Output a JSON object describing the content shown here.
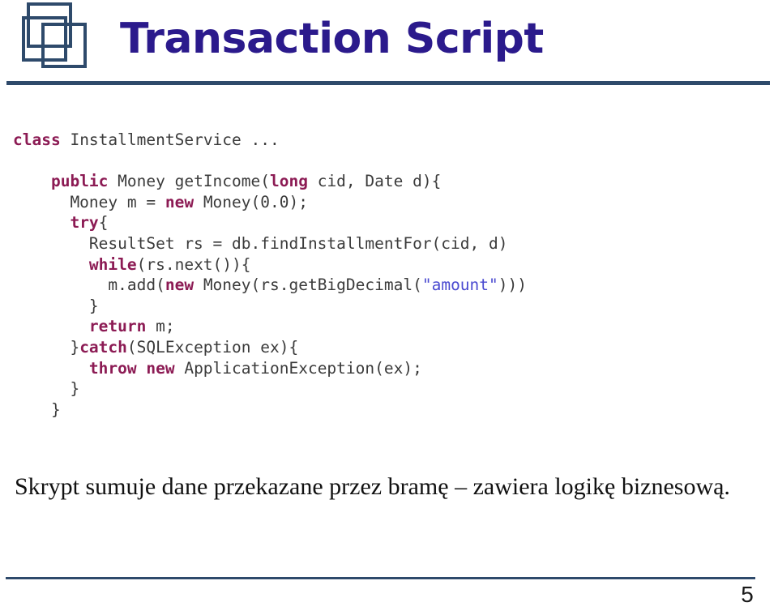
{
  "slide": {
    "title": "Transaction Script",
    "page_number": "5",
    "colors": {
      "title": "#2b1a8c",
      "rule": "#2e4a6b",
      "logo": "#2e4a6b",
      "code_keyword": "#8c1b54",
      "code_string": "#4a4ad0",
      "code_plain": "#3b3b3b",
      "body_text": "#111111",
      "background": "#ffffff"
    },
    "logo": {
      "icon_name": "three-overlapping-squares-logo"
    }
  },
  "code": {
    "language": "java",
    "lines": [
      [
        {
          "t": "class ",
          "c": "kw"
        },
        {
          "t": "InstallmentService ...",
          "c": "plain"
        }
      ],
      [],
      [
        {
          "t": "    ",
          "c": "plain"
        },
        {
          "t": "public ",
          "c": "kw"
        },
        {
          "t": "Money getIncome(",
          "c": "plain"
        },
        {
          "t": "long ",
          "c": "kw"
        },
        {
          "t": "cid, Date d){",
          "c": "plain"
        }
      ],
      [
        {
          "t": "      Money m = ",
          "c": "plain"
        },
        {
          "t": "new ",
          "c": "kw"
        },
        {
          "t": "Money(0.0);",
          "c": "plain"
        }
      ],
      [
        {
          "t": "      ",
          "c": "plain"
        },
        {
          "t": "try",
          "c": "kw"
        },
        {
          "t": "{",
          "c": "plain"
        }
      ],
      [
        {
          "t": "        ResultSet rs = db.findInstallmentFor(cid, d)",
          "c": "plain"
        }
      ],
      [
        {
          "t": "        ",
          "c": "plain"
        },
        {
          "t": "while",
          "c": "kw"
        },
        {
          "t": "(rs.next()){",
          "c": "plain"
        }
      ],
      [
        {
          "t": "          m.add(",
          "c": "plain"
        },
        {
          "t": "new ",
          "c": "kw"
        },
        {
          "t": "Money(rs.getBigDecimal(",
          "c": "plain"
        },
        {
          "t": "\"amount\"",
          "c": "str"
        },
        {
          "t": ")))",
          "c": "plain"
        }
      ],
      [
        {
          "t": "        }",
          "c": "plain"
        }
      ],
      [
        {
          "t": "        ",
          "c": "plain"
        },
        {
          "t": "return ",
          "c": "kw"
        },
        {
          "t": "m;",
          "c": "plain"
        }
      ],
      [
        {
          "t": "      }",
          "c": "plain"
        },
        {
          "t": "catch",
          "c": "kw"
        },
        {
          "t": "(SQLException ex){",
          "c": "plain"
        }
      ],
      [
        {
          "t": "        ",
          "c": "plain"
        },
        {
          "t": "throw new ",
          "c": "kw"
        },
        {
          "t": "ApplicationException(ex);",
          "c": "plain"
        }
      ],
      [
        {
          "t": "      }",
          "c": "plain"
        }
      ],
      [
        {
          "t": "    }",
          "c": "plain"
        }
      ]
    ]
  },
  "body": {
    "paragraph": "Skrypt sumuje dane przekazane przez bramę – zawiera logikę biznesową."
  }
}
